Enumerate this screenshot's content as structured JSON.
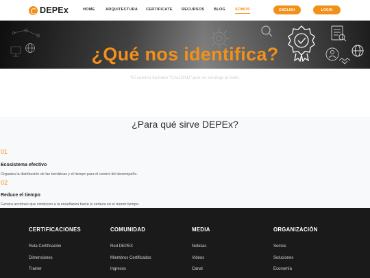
{
  "header": {
    "logo_text": "DEPEx",
    "nav": [
      "HOME",
      "ARQUITECTURA",
      "CERTIFICATE",
      "RECURSOS",
      "BLOG",
      "SOMOS"
    ],
    "active_nav": "SOMOS",
    "english_label": "ENGLISH",
    "login_label": "LOGIN"
  },
  "hero": {
    "title": "¿Qué nos identifica?",
    "icons": [
      "gear-icon",
      "globe-icon",
      "badge-check-icon",
      "document-icon",
      "handshake-icon",
      "person-icon",
      "search-icon"
    ]
  },
  "quote": "\"El camino llamado \"CALIDAD\",que no conduje al éxito.",
  "purpose": {
    "title": "¿Para qué sirve DEPEx?",
    "items": [
      {
        "number": "01",
        "title": "Ecosistema efectivo",
        "description": "Organiza la distribución de las temáticas y el tiempo para el control del desempeño."
      },
      {
        "number": "02",
        "title": "Reduce el tiempo",
        "description": "Genera acciones que conducen a la enseñanza hacia la certeza en el menor tiempo."
      }
    ]
  },
  "footer": {
    "columns": [
      {
        "heading": "CERTIFICACIONES",
        "links": [
          "Ruta Certificación",
          "Dimensiones",
          "Trainer"
        ]
      },
      {
        "heading": "COMUNIDAD",
        "links": [
          "Red DEPEX",
          "Miembros Certificados",
          "Ingresos"
        ]
      },
      {
        "heading": "MEDIA",
        "links": [
          "Noticias",
          "Videos",
          "Canal"
        ]
      },
      {
        "heading": "ORGANIZACIÓN",
        "links": [
          "Somos",
          "Soluciones",
          "Economía"
        ]
      }
    ]
  },
  "colors": {
    "accent": "#f39019",
    "footer_bg": "#1a1a1a",
    "section_bg": "#f8f9fb"
  }
}
